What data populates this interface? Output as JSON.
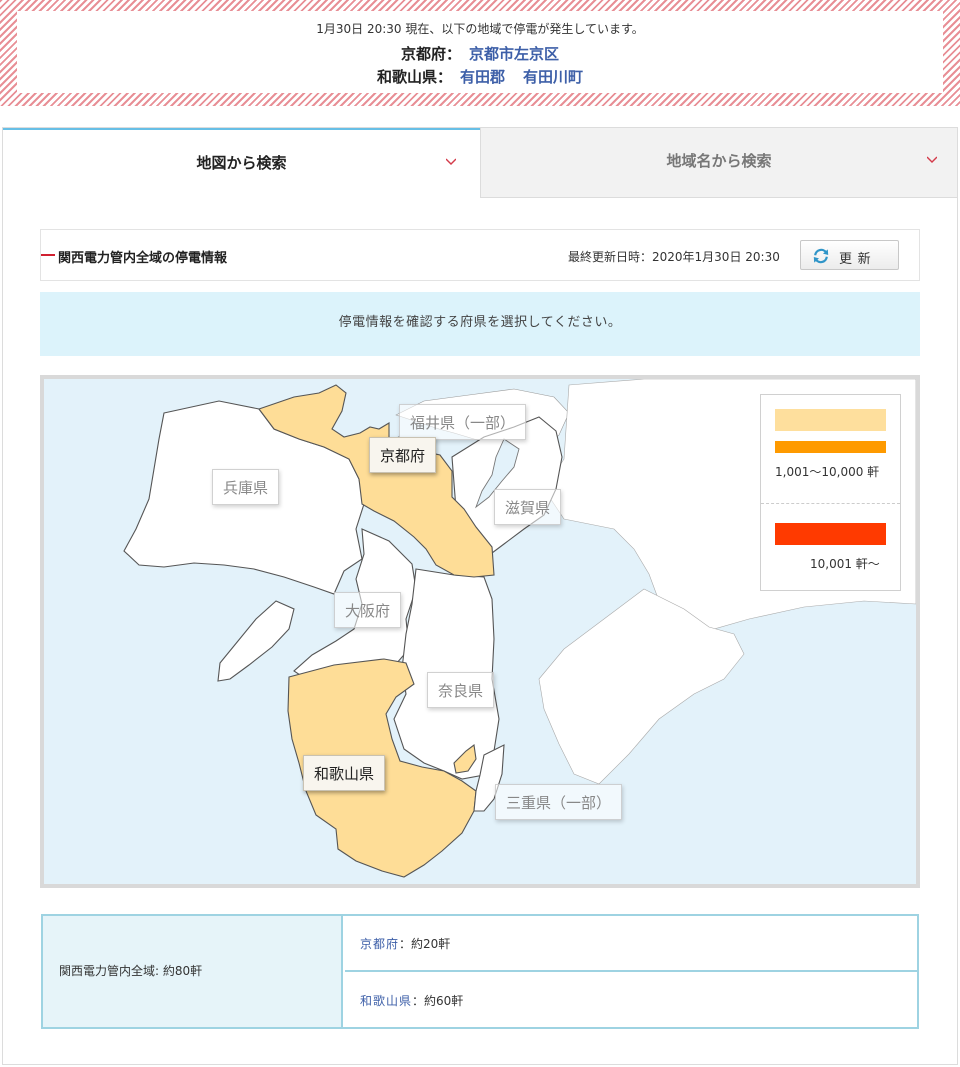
{
  "alert": {
    "headline": "1月30日 20:30 現在、以下の地域で停電が発生しています。",
    "rows": [
      {
        "prefecture": "京都府：",
        "areas": [
          "京都市左京区"
        ]
      },
      {
        "prefecture": "和歌山県：",
        "areas": [
          "有田郡",
          "有田川町"
        ]
      }
    ]
  },
  "tabs": [
    {
      "label": "地図から検索",
      "active": true
    },
    {
      "label": "地域名から検索",
      "active": false
    }
  ],
  "info": {
    "title": "関西電力管内全域の停電情報",
    "updated": "最終更新日時：2020年1月30日 20:30",
    "refresh_label": "更 新"
  },
  "notice": "停電情報を確認する府県を選択してください。",
  "map": {
    "prefectures": [
      {
        "label": "福井県（一部）",
        "active": false
      },
      {
        "label": "京都府",
        "active": true
      },
      {
        "label": "兵庫県",
        "active": false
      },
      {
        "label": "滋賀県",
        "active": false
      },
      {
        "label": "大阪府",
        "active": false
      },
      {
        "label": "奈良県",
        "active": false
      },
      {
        "label": "和歌山県",
        "active": true
      },
      {
        "label": "三重県（一部）",
        "active": false
      }
    ],
    "legend": [
      {
        "color": "#fedf9d",
        "label": ""
      },
      {
        "color": "#fe9a00",
        "label": "1,001〜10,000 軒"
      },
      {
        "color": "#ff3a00",
        "label": "10,001 軒〜"
      }
    ],
    "colors": {
      "sea": "#e3f2fa",
      "land": "#ffffff",
      "outage_low": "#fedd97",
      "border": "#555555"
    }
  },
  "stats": {
    "total": "関西電力管内全域: 約80軒",
    "rows": [
      {
        "name": "京都府",
        "sep": "：約20軒"
      },
      {
        "name": "和歌山県",
        "sep": "：約60軒"
      }
    ]
  },
  "icons": {
    "tab_chevron": "chevron-down-icon",
    "refresh": "refresh-icon"
  }
}
